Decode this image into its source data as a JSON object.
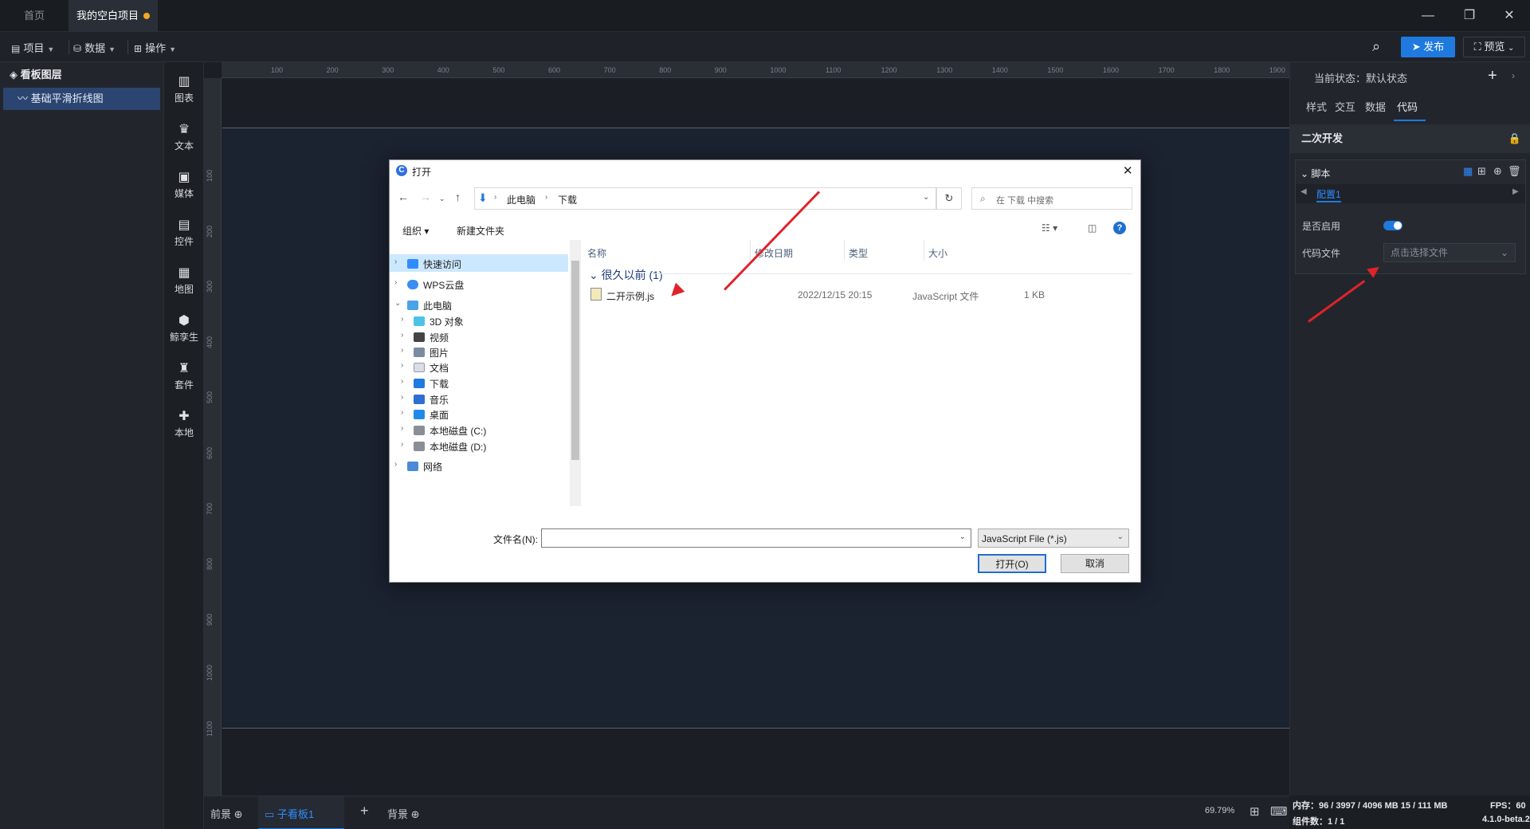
{
  "tabs": {
    "home": "首页",
    "project": "我的空白项目"
  },
  "toolbar": {
    "menus": [
      "项目",
      "数据",
      "操作"
    ],
    "publish": "发布",
    "preview": "预览"
  },
  "layers": {
    "title": "看板图层",
    "items": [
      "基础平滑折线图"
    ]
  },
  "iconbar": [
    "图表",
    "文本",
    "媒体",
    "控件",
    "地图",
    "鲸孪生",
    "套件",
    "本地"
  ],
  "ruler": {
    "h": [
      "100",
      "200",
      "300",
      "400",
      "500",
      "600",
      "700",
      "800",
      "900",
      "1000",
      "1100",
      "1200",
      "1300",
      "1400",
      "1500",
      "1600",
      "1700",
      "1800",
      "1900"
    ],
    "v": [
      "100",
      "200",
      "300",
      "400",
      "500",
      "600",
      "700",
      "800",
      "900",
      "1000",
      "1100"
    ]
  },
  "bottombar": {
    "foreground": "前景",
    "sub_board": "子看板1",
    "background": "背景",
    "zoom": "69.79%"
  },
  "right_panel": {
    "state_label": "当前状态：默认状态",
    "tabs": [
      "样式",
      "交互",
      "数据",
      "代码"
    ],
    "dev_title": "二次开发",
    "script_title": "脚本",
    "config_tab": "配置1",
    "enable_label": "是否启用",
    "code_file_label": "代码文件",
    "code_file_placeholder": "点击选择文件"
  },
  "status": {
    "memory": "内存：96 / 3997 / 4096 MB  15 / 111 MB",
    "fps": "FPS：60",
    "components": "组件数：1 / 1",
    "version": "4.1.0-beta.2"
  },
  "dialog": {
    "title": "打开",
    "path": [
      "此电脑",
      "下载"
    ],
    "search_placeholder": "在 下载 中搜索",
    "organize": "组织 ▾",
    "new_folder": "新建文件夹",
    "tree": [
      "快速访问",
      "WPS云盘",
      "此电脑",
      "3D 对象",
      "视频",
      "图片",
      "文档",
      "下载",
      "音乐",
      "桌面",
      "本地磁盘 (C:)",
      "本地磁盘 (D:)",
      "网络"
    ],
    "columns": [
      "名称",
      "修改日期",
      "类型",
      "大小"
    ],
    "group": "很久以前 (1)",
    "file": {
      "name": "二开示例.js",
      "date": "2022/12/15 20:15",
      "type": "JavaScript 文件",
      "size": "1 KB"
    },
    "filename_label": "文件名(N):",
    "filter": "JavaScript File (*.js)",
    "open": "打开(O)",
    "cancel": "取消"
  },
  "colors": {
    "accent": "#1f7ae0",
    "annotation_arrow": "#e0222a",
    "unsaved_dot": "#f5a623"
  }
}
